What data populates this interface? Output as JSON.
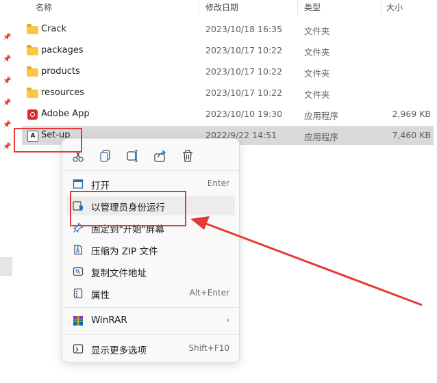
{
  "columns": {
    "name": "名称",
    "date": "修改日期",
    "type": "类型",
    "size": "大小"
  },
  "files": [
    {
      "name": "Crack",
      "date": "2023/10/18 16:35",
      "type": "文件夹",
      "size": "",
      "icon": "folder-icon"
    },
    {
      "name": "packages",
      "date": "2023/10/17 10:22",
      "type": "文件夹",
      "size": "",
      "icon": "folder-icon"
    },
    {
      "name": "products",
      "date": "2023/10/17 10:22",
      "type": "文件夹",
      "size": "",
      "icon": "folder-icon"
    },
    {
      "name": "resources",
      "date": "2023/10/17 10:22",
      "type": "文件夹",
      "size": "",
      "icon": "folder-icon"
    },
    {
      "name": "Adobe App",
      "date": "2023/10/10 19:30",
      "type": "应用程序",
      "size": "2,969 KB",
      "icon": "adobe-app-icon"
    },
    {
      "name": "Set-up",
      "date": "2022/9/22 14:51",
      "type": "应用程序",
      "size": "7,460 KB",
      "icon": "setup-app-icon",
      "selected": true
    }
  ],
  "context_menu": {
    "quick_actions": [
      "cut-icon",
      "copy-icon",
      "rename-icon",
      "share-icon",
      "delete-icon"
    ],
    "open": {
      "label": "打开",
      "shortcut": "Enter"
    },
    "run_as_admin": {
      "label": "以管理员身份运行"
    },
    "pin_start": {
      "label": "固定到\"开始\"屏幕"
    },
    "compress_zip": {
      "label": "压缩为 ZIP 文件"
    },
    "copy_path": {
      "label": "复制文件地址"
    },
    "properties": {
      "label": "属性",
      "shortcut": "Alt+Enter"
    },
    "winrar": {
      "label": "WinRAR"
    },
    "more_options": {
      "label": "显示更多选项",
      "shortcut": "Shift+F10"
    }
  },
  "colors": {
    "highlight": "#e53935",
    "selection": "#d9d9d9",
    "folder": "#f8c93f"
  }
}
